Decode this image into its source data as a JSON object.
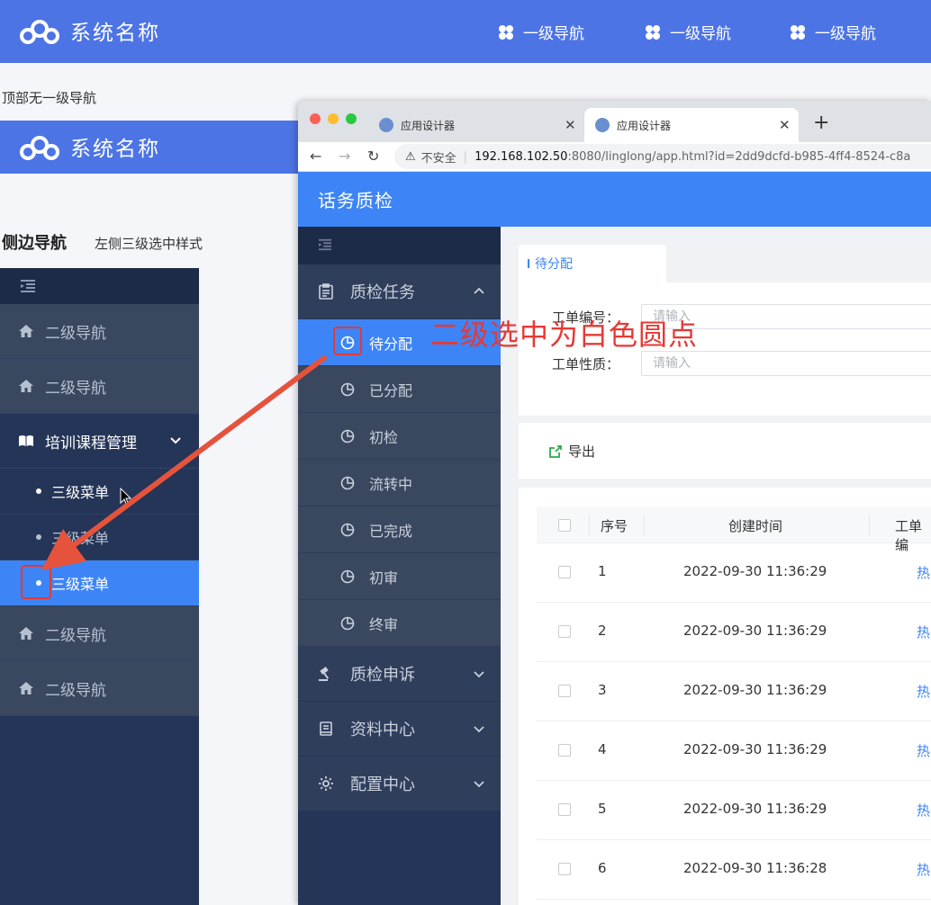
{
  "top_header": {
    "logo_text": "系统名称",
    "nav": [
      "一级导航",
      "一级导航",
      "一级导航"
    ]
  },
  "section_top_label": "顶部无一级导航",
  "second_header": {
    "logo_text": "系统名称"
  },
  "side_nav": {
    "title": "侧边导航",
    "subtitle": "左侧三级选中样式",
    "items": [
      {
        "label": "二级导航",
        "icon": "home-icon"
      },
      {
        "label": "二级导航",
        "icon": "home-icon"
      },
      {
        "label": "培训课程管理",
        "icon": "book-icon",
        "expanded": true,
        "children": [
          "三级菜单",
          "三级菜单",
          "三级菜单"
        ],
        "active_child": 2
      },
      {
        "label": "二级导航",
        "icon": "home-icon"
      },
      {
        "label": "二级导航",
        "icon": "home-icon"
      }
    ]
  },
  "browser": {
    "tabs": [
      "应用设计器",
      "应用设计器"
    ],
    "address": {
      "security": "不安全",
      "host": "192.168.102.50",
      "rest": ":8080/linglong/app.html?id=2dd9dcfd-b985-4ff4-8524-c8a"
    }
  },
  "app": {
    "title": "话务质检",
    "menu": [
      {
        "label": "质检任务",
        "icon": "clipboard-icon",
        "expanded": true,
        "children": [
          "待分配",
          "已分配",
          "初检",
          "流转中",
          "已完成",
          "初审",
          "终审"
        ],
        "active_child": 0
      },
      {
        "label": "质检申诉",
        "icon": "gavel-icon"
      },
      {
        "label": "资料中心",
        "icon": "book-icon"
      },
      {
        "label": "配置中心",
        "icon": "gear-icon"
      }
    ],
    "breadcrumb_tab": "待分配",
    "filters": [
      {
        "label": "工单编号：",
        "placeholder": "请输入"
      },
      {
        "label": "工单性质：",
        "placeholder": "请输入"
      }
    ],
    "export_label": "导出",
    "table": {
      "columns": [
        "序号",
        "创建时间",
        "工单编"
      ],
      "rows": [
        {
          "no": "1",
          "time": "2022-09-30 11:36:29",
          "type": "热"
        },
        {
          "no": "2",
          "time": "2022-09-30 11:36:29",
          "type": "热"
        },
        {
          "no": "3",
          "time": "2022-09-30 11:36:29",
          "type": "热"
        },
        {
          "no": "4",
          "time": "2022-09-30 11:36:29",
          "type": "热"
        },
        {
          "no": "5",
          "time": "2022-09-30 11:36:29",
          "type": "热"
        },
        {
          "no": "6",
          "time": "2022-09-30 11:36:28",
          "type": "热"
        }
      ]
    }
  },
  "annotation": {
    "text": "二级选中为白色圆点"
  },
  "colors": {
    "header_blue": "#4d74e5",
    "app_blue": "#3d85f7",
    "sidebar_navy": "#243557",
    "annotation_red": "#e53935"
  }
}
